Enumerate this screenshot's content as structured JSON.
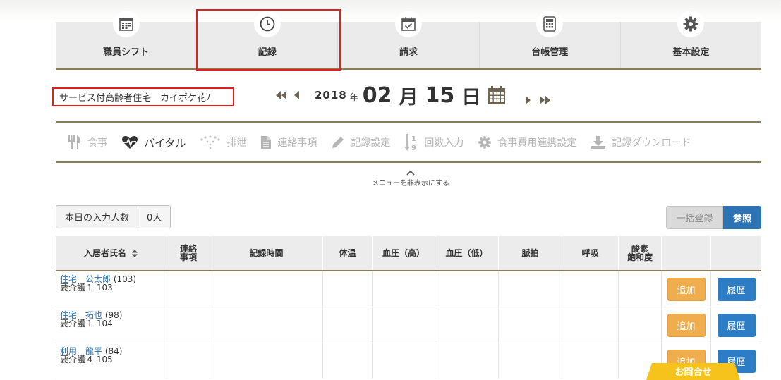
{
  "nav": {
    "tabs": [
      {
        "label": "職員シフト",
        "icon": "calendar-grid-icon"
      },
      {
        "label": "記録",
        "icon": "clock-icon"
      },
      {
        "label": "請求",
        "icon": "calendar-check-icon"
      },
      {
        "label": "台帳管理",
        "icon": "calculator-icon"
      },
      {
        "label": "基本設定",
        "icon": "gear-icon"
      }
    ]
  },
  "facility": {
    "value": "サービス付高齢者住宅　カイポケ花ﾉ"
  },
  "date": {
    "year": "2018",
    "year_unit": "年",
    "month": "02",
    "month_unit": "月",
    "day": "15",
    "day_unit": "日"
  },
  "submenu": {
    "items": [
      {
        "label": "食事",
        "icon": "utensils-icon"
      },
      {
        "label": "バイタル",
        "icon": "heart-pulse-icon"
      },
      {
        "label": "排泄",
        "icon": "drops-icon"
      },
      {
        "label": "連絡事項",
        "icon": "document-icon"
      },
      {
        "label": "記録設定",
        "icon": "pencil-icon"
      },
      {
        "label": "回数入力",
        "icon": "sort-numeric-icon"
      },
      {
        "label": "食事費用連携設定",
        "icon": "gear-icon"
      },
      {
        "label": "記録ダウンロード",
        "icon": "download-icon"
      }
    ],
    "toggle_label": "メニューを非表示にする"
  },
  "counter": {
    "label": "本日の入力人数",
    "value": "0人"
  },
  "actions": {
    "bulk_label": "一括登録",
    "ref_label": "参照"
  },
  "table": {
    "headers": {
      "name": "入居者氏名",
      "contact_1": "連絡",
      "contact_2": "事項",
      "time": "記録時間",
      "temp": "体温",
      "bp_high": "血圧（高）",
      "bp_low": "血圧（低）",
      "pulse": "脈拍",
      "resp": "呼吸",
      "spo2_1": "酸素",
      "spo2_2": "飽和度"
    },
    "rows": [
      {
        "name": "住宅　公太郎",
        "age": "(103)",
        "care": "要介護１ 103",
        "add": "追加",
        "history": "履歴"
      },
      {
        "name": "住宅　拓也",
        "age": "(98)",
        "care": "要介護１ 104",
        "add": "追加",
        "history": "履歴"
      },
      {
        "name": "利用　龍平",
        "age": "(84)",
        "care": "要介護４ 105",
        "add": "追加",
        "history": "履歴"
      }
    ]
  },
  "contact_tab": "お問合せ",
  "colors": {
    "accent_line": "#8a7d5c",
    "highlight": "#e0201f",
    "primary": "#2d72b3",
    "add": "#f0ad4e"
  }
}
